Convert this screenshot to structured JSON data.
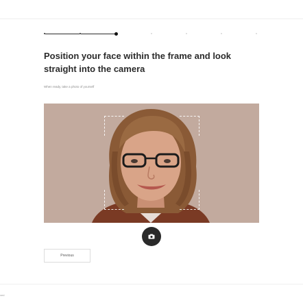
{
  "progress": {
    "total_steps": 8,
    "current_step": 3
  },
  "headline": "Position your face within the frame and look straight into the camera",
  "subtext": "When ready, take a photo of yourself",
  "camera": {
    "background_color": "#c2aa9e",
    "frame_guides": "dashed-corner-brackets"
  },
  "shutter_button": {
    "icon": "camera-icon"
  },
  "previous_button": {
    "label": "Previous"
  },
  "footer": {
    "text": "ved"
  }
}
